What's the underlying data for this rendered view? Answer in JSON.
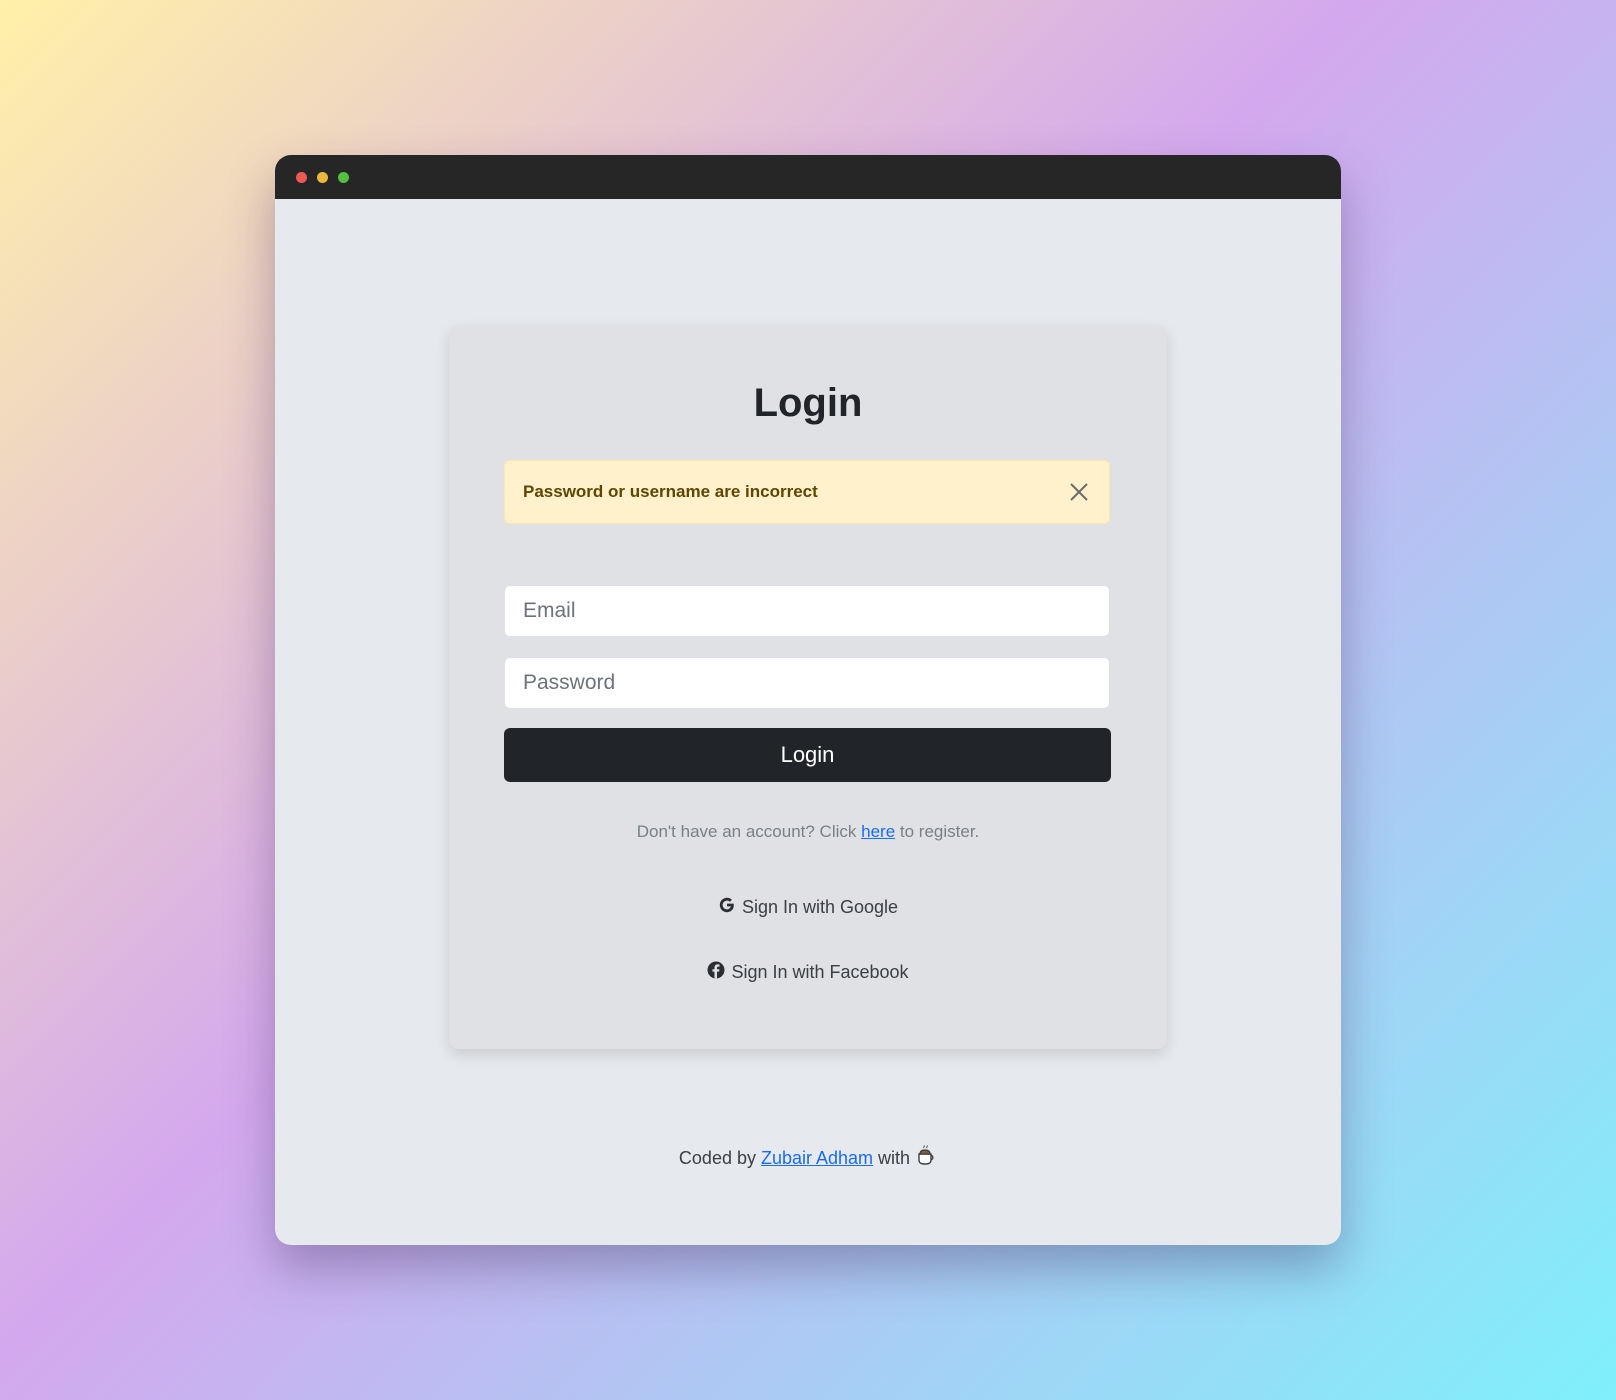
{
  "window": {
    "controls": [
      "close",
      "minimize",
      "maximize"
    ]
  },
  "card": {
    "title": "Login",
    "alert": {
      "message": "Password or username are incorrect",
      "close_icon": "close-icon"
    },
    "email_input": {
      "placeholder": "Email",
      "value": ""
    },
    "password_input": {
      "placeholder": "Password",
      "value": ""
    },
    "login_button": "Login",
    "register": {
      "prefix": "Don't have an account? Click",
      "link": "here",
      "suffix": "to register."
    },
    "google_button": {
      "icon": "google-icon",
      "label": "Sign In with Google"
    },
    "facebook_button": {
      "icon": "facebook-icon",
      "label": "Sign In with Facebook"
    }
  },
  "footer": {
    "prefix": "Coded by",
    "author": "Zubair Adham",
    "suffix": "with",
    "icon": "coffee-icon"
  },
  "colors": {
    "titlebar": "#262626",
    "alert_bg": "#fff1cc",
    "alert_text": "#5f4604",
    "button": "#212529",
    "link": "#1a6cf0"
  }
}
